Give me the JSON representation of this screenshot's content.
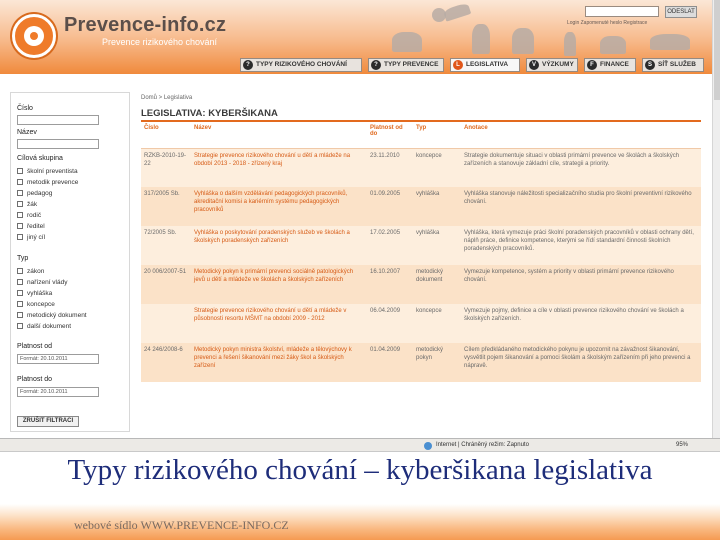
{
  "site": {
    "logo_title": "Prevence-info.cz",
    "logo_subtitle": "Prevence rizikového chování",
    "login_placeholder": "",
    "login_button": "ODESLAT",
    "login_links": "Login   Zapomenuté heslo   Registrace"
  },
  "menu": [
    {
      "icon": "?",
      "label": "TYPY RIZIKOVÉHO CHOVÁNÍ"
    },
    {
      "icon": "?",
      "label": "TYPY PREVENCE"
    },
    {
      "icon": "L",
      "label": "LEGISLATIVA",
      "active": true
    },
    {
      "icon": "V",
      "label": "VÝZKUMY"
    },
    {
      "icon": "F",
      "label": "FINANCE"
    },
    {
      "icon": "S",
      "label": "SÍŤ SLUŽEB"
    }
  ],
  "filters": {
    "cislo_label": "Číslo",
    "nazev_label": "Název",
    "cilova_label": "Cílová skupina",
    "cilova_options": [
      "školní preventista",
      "metodik prevence",
      "pedagog",
      "žák",
      "rodič",
      "ředitel",
      "jiný cíl"
    ],
    "typ_label": "Typ",
    "typ_options": [
      "zákon",
      "nařízení vlády",
      "vyhláška",
      "koncepce",
      "metodický dokument",
      "další dokument"
    ],
    "platnost_od_label": "Platnost od",
    "platnost_od_value": "Formát: 20.10.2011",
    "platnost_do_label": "Platnost do",
    "platnost_do_value": "Formát: 20.10.2011",
    "submit": "ZRUŠIT FILTRACI"
  },
  "main": {
    "breadcrumb": "Domů > Legislativa",
    "title": "LEGISLATIVA: KYBERŠIKANA",
    "columns": [
      "Číslo",
      "Název",
      "Platnost od do",
      "Typ",
      "Anotace"
    ],
    "rows": [
      {
        "cislo": "RZKB-2010-19-22",
        "nazev": "Strategie prevence rizikového chování u dětí a mládeže na období 2013 - 2018 - zřízený kraj",
        "platnost": "23.11.2010",
        "typ": "koncepce",
        "anotace": "Strategie dokumentuje situaci v oblasti primární prevence ve školách a školských zařízeních a stanovuje základní cíle, strategii a priority."
      },
      {
        "cislo": "317/2005 Sb.",
        "nazev": "Vyhláška o dalším vzdělávání pedagogických pracovníků, akreditační komisi a kariérním systému pedagogických pracovníků",
        "platnost": "01.09.2005",
        "typ": "vyhláška",
        "anotace": "Vyhláška stanovuje náležitosti specializačního studia pro školní preventivní rizikového chování."
      },
      {
        "cislo": "72/2005 Sb.",
        "nazev": "Vyhláška o poskytování poradenských služeb ve školách a školských poradenských zařízeních",
        "platnost": "17.02.2005",
        "typ": "vyhláška",
        "anotace": "Vyhláška, která vymezuje práci školní poradenských pracovníků v oblasti ochrany dětí, náplň práce, definice kompetence, kterými se řídí standardní činnosti školních poradenských pracovníků."
      },
      {
        "cislo": "20 006/2007-51",
        "nazev": "Metodický pokyn k primární prevenci sociálně patologických jevů u dětí a mládeže ve školách a školských zařízeních",
        "platnost": "16.10.2007",
        "typ": "metodický dokument",
        "anotace": "Vymezuje kompetence, systém a priority v oblasti primární prevence rizikového chování."
      },
      {
        "cislo": "",
        "nazev": "Strategie prevence rizikového chování u dětí a mládeže v působnosti resortu MŠMT na období 2009 - 2012",
        "platnost": "06.04.2009",
        "typ": "koncepce",
        "anotace": "Vymezuje pojmy, definice a cíle v oblasti prevence rizikového chování ve školách a školských zařízeních."
      },
      {
        "cislo": "24 246/2008-6",
        "nazev": "Metodický pokyn ministra školství, mládeže a tělovýchovy k prevenci a řešení šikanování mezi žáky škol a školských zařízení",
        "platnost": "01.04.2009",
        "typ": "metodický pokyn",
        "anotace": "Cílem předkládaného metodického pokynu je upozornit na závažnost šikanování, vysvětlit pojem šikanování a pomoci školám a školským zařízením při jeho prevenci a nápravě."
      }
    ]
  },
  "statusbar": {
    "zone": "Internet | Chráněný režim: Zapnuto",
    "zoom": "95%"
  },
  "slide": {
    "caption": "Typy rizikového chování – kyberšikana legislativa",
    "footer": "webové sídlo WWW.PREVENCE-INFO.CZ"
  }
}
